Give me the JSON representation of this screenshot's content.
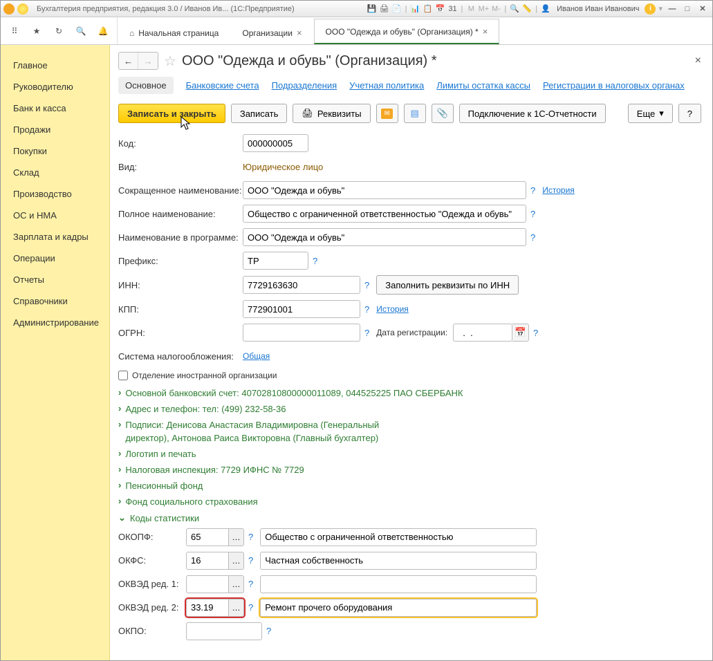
{
  "titlebar": {
    "title": "Бухгалтерия предприятия, редакция 3.0 / Иванов Ив...  (1С:Предприятие)",
    "user": "Иванов Иван Иванович"
  },
  "tabs": {
    "home": "Начальная страница",
    "org": "Организации",
    "current": "ООО \"Одежда и обувь\" (Организация) *"
  },
  "sidebar": {
    "items": [
      "Главное",
      "Руководителю",
      "Банк и касса",
      "Продажи",
      "Покупки",
      "Склад",
      "Производство",
      "ОС и НМА",
      "Зарплата и кадры",
      "Операции",
      "Отчеты",
      "Справочники",
      "Администрирование"
    ]
  },
  "page": {
    "title": "ООО \"Одежда и обувь\" (Организация) *"
  },
  "subtabs": {
    "main": "Основное",
    "bank": "Банковские счета",
    "dept": "Подразделения",
    "policy": "Учетная политика",
    "limits": "Лимиты остатка кассы",
    "reg": "Регистрации в налоговых органах"
  },
  "actions": {
    "save_close": "Записать и закрыть",
    "save": "Записать",
    "props": "Реквизиты",
    "connect": "Подключение к 1С-Отчетности",
    "more": "Еще",
    "help": "?"
  },
  "form": {
    "code_lbl": "Код:",
    "code_val": "000000005",
    "kind_lbl": "Вид:",
    "kind_val": "Юридическое лицо",
    "short_lbl": "Сокращенное наименование:",
    "short_val": "ООО \"Одежда и обувь\"",
    "history": "История",
    "full_lbl": "Полное наименование:",
    "full_val": "Общество с ограниченной ответственностью \"Одежда и обувь\"",
    "prog_lbl": "Наименование в программе:",
    "prog_val": "ООО \"Одежда и обувь\"",
    "prefix_lbl": "Префикс:",
    "prefix_val": "ТР",
    "inn_lbl": "ИНН:",
    "inn_val": "7729163630",
    "inn_btn": "Заполнить реквизиты по ИНН",
    "kpp_lbl": "КПП:",
    "kpp_val": "772901001",
    "ogrn_lbl": "ОГРН:",
    "ogrn_val": "",
    "regdate_lbl": "Дата регистрации:",
    "regdate_val": "  .  .    ",
    "tax_lbl": "Система налогообложения:",
    "tax_val": "Общая",
    "foreign_lbl": "Отделение иностранной организации"
  },
  "collapsibles": {
    "bank": "Основной банковский счет: 40702810800000011089, 044525225 ПАО СБЕРБАНК",
    "address": "Адрес и телефон: тел: (499) 232-58-36",
    "signatures": "Подписи: Денисова Анастасия Владимировна (Генеральный директор), Антонова Раиса Викторовна (Главный бухгалтер)",
    "logo": "Логотип и печать",
    "tax_insp": "Налоговая инспекция: 7729 ИФНС № 7729",
    "pension": "Пенсионный фонд",
    "social": "Фонд социального страхования",
    "stats": "Коды статистики"
  },
  "stats": {
    "okopf_lbl": "ОКОПФ:",
    "okopf_code": "65",
    "okopf_desc": "Общество с ограниченной ответственностью",
    "okfs_lbl": "ОКФС:",
    "okfs_code": "16",
    "okfs_desc": "Частная собственность",
    "okved1_lbl": "ОКВЭД ред. 1:",
    "okved1_code": "",
    "okved1_desc": "",
    "okved2_lbl": "ОКВЭД ред. 2:",
    "okved2_code": "33.19",
    "okved2_desc": "Ремонт прочего оборудования",
    "okpo_lbl": "ОКПО:",
    "okpo_val": ""
  }
}
